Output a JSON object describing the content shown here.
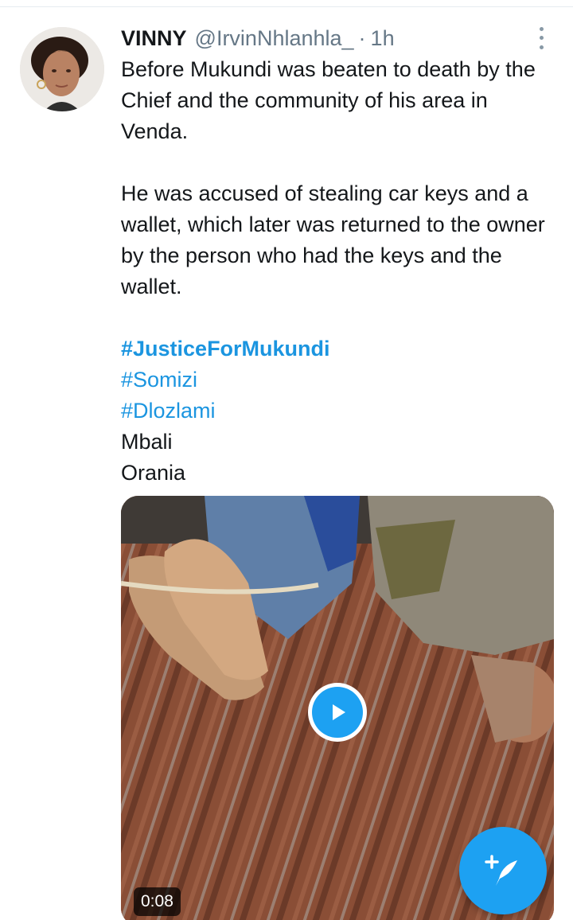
{
  "tweet": {
    "author_name": "VINNY",
    "handle": "@IrvinNhlanhla_",
    "separator": "·",
    "time": "1h",
    "paragraphs": [
      "Before Mukundi was beaten to death by the Chief and the community of his area in Venda.",
      "He was accused of stealing car keys and a wallet, which later was returned to the owner by the person who had the keys and the wallet."
    ],
    "hashtags": [
      "#JusticeForMukundi",
      "#Somizi",
      "#Dlozlami"
    ],
    "extra_lines": [
      "Mbali",
      "Orania"
    ]
  },
  "media": {
    "duration": "0:08"
  },
  "icons": {
    "more": "more-vertical-icon",
    "play": "play-icon",
    "compose": "compose-tweet-icon"
  },
  "colors": {
    "link": "#1b95e0",
    "accent": "#1da1f2",
    "text": "#14171a",
    "muted": "#657786"
  }
}
